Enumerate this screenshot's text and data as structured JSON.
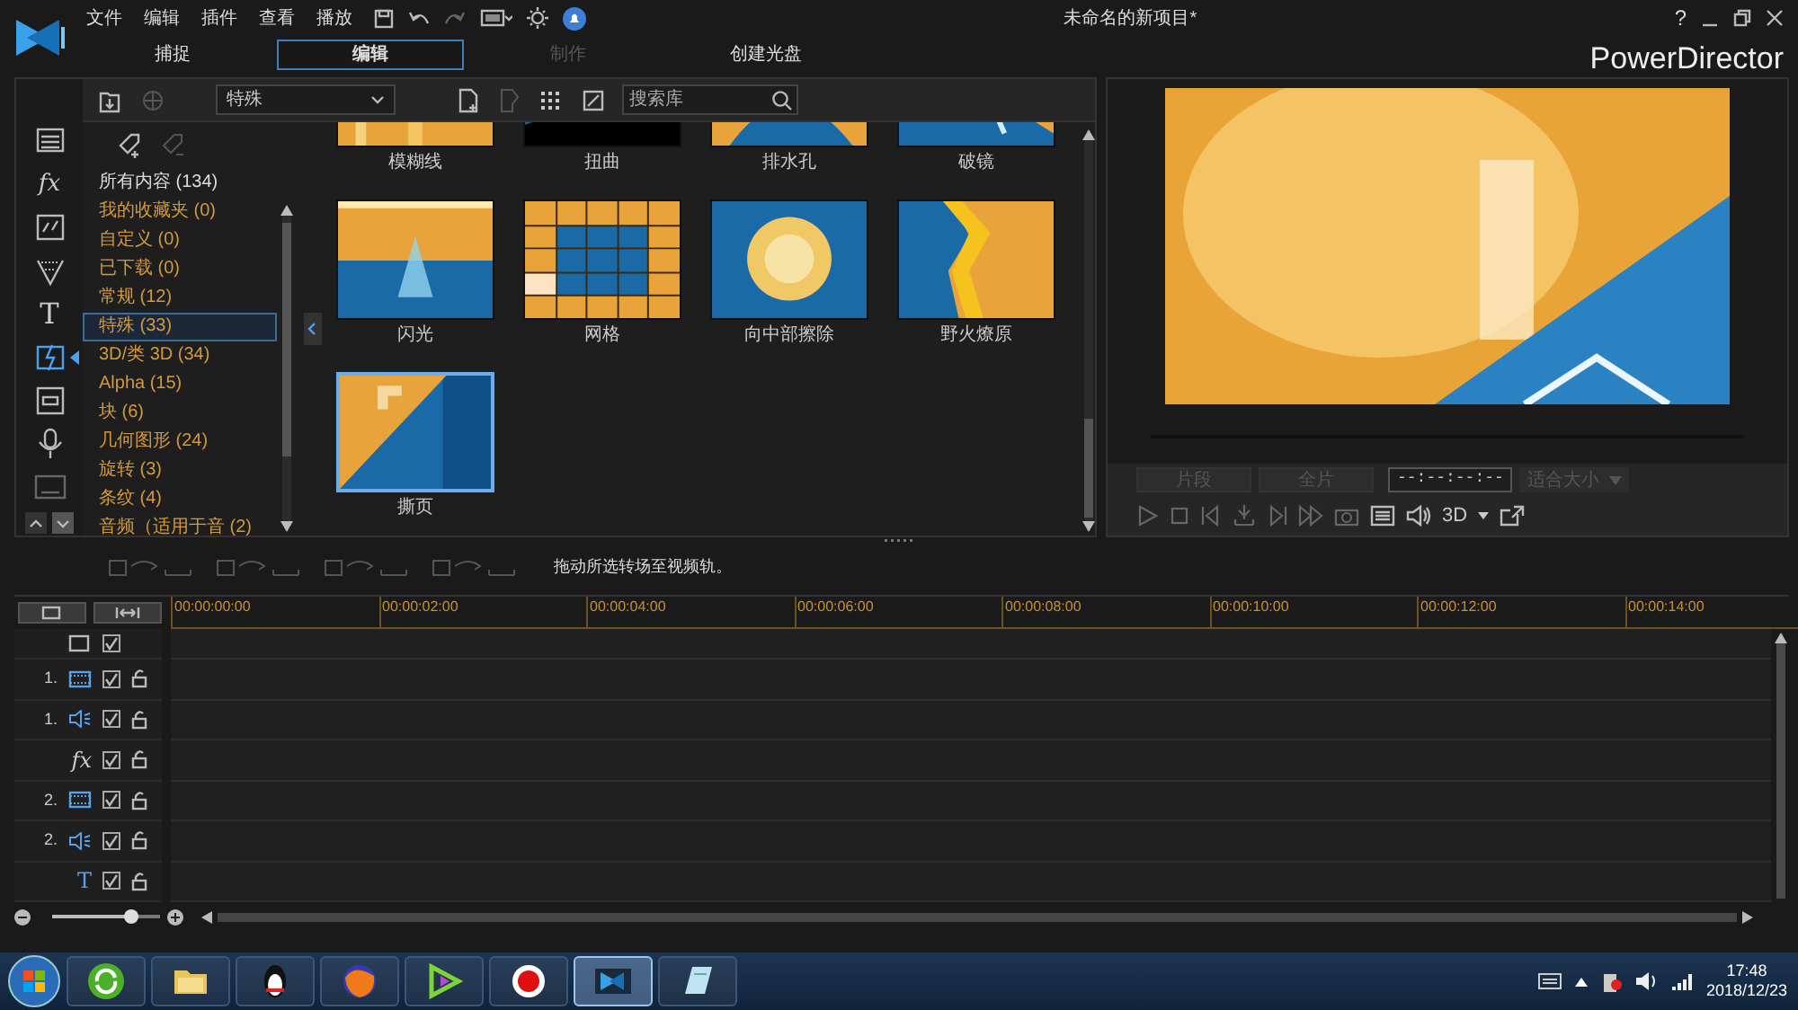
{
  "menus": [
    "文件",
    "编辑",
    "插件",
    "查看",
    "播放"
  ],
  "window": {
    "title": "未命名的新项目*",
    "help": "?"
  },
  "tabs": [
    {
      "label": "捕捉",
      "selected": false,
      "disabled": false
    },
    {
      "label": "编辑",
      "selected": true,
      "disabled": false
    },
    {
      "label": "制作",
      "selected": false,
      "disabled": true
    },
    {
      "label": "创建光盘",
      "selected": false,
      "disabled": false
    }
  ],
  "brand": "PowerDirector",
  "rail": [
    {
      "kind": "media",
      "selected": false
    },
    {
      "kind": "fx",
      "label": "fx",
      "selected": false
    },
    {
      "kind": "pip",
      "selected": false
    },
    {
      "kind": "particle",
      "selected": false
    },
    {
      "kind": "title",
      "label": "T",
      "selected": false
    },
    {
      "kind": "transition",
      "selected": true
    },
    {
      "kind": "chapter",
      "selected": false
    },
    {
      "kind": "voice",
      "selected": false
    },
    {
      "kind": "subtitle",
      "selected": false
    }
  ],
  "library": {
    "category_select": "特殊",
    "search": {
      "placeholder": "搜索库"
    },
    "categories": [
      {
        "kind": "all",
        "label": "所有内容 (134)",
        "selected": false
      },
      {
        "kind": "category",
        "label": "我的收藏夹  (0)",
        "selected": false
      },
      {
        "kind": "category",
        "label": "自定义  (0)",
        "selected": false
      },
      {
        "kind": "category",
        "label": "已下载  (0)",
        "selected": false
      },
      {
        "kind": "category",
        "label": "常规  (12)",
        "selected": false
      },
      {
        "kind": "category",
        "label": "特殊  (33)",
        "selected": true
      },
      {
        "kind": "category",
        "label": "3D/类 3D  (34)",
        "selected": false
      },
      {
        "kind": "category",
        "label": "Alpha  (15)",
        "selected": false
      },
      {
        "kind": "category",
        "label": "块  (6)",
        "selected": false
      },
      {
        "kind": "category",
        "label": "几何图形  (24)",
        "selected": false
      },
      {
        "kind": "category",
        "label": "旋转  (3)",
        "selected": false
      },
      {
        "kind": "category",
        "label": "条纹  (4)",
        "selected": false
      },
      {
        "kind": "category",
        "label": "音频（适用于音      (2)",
        "selected": false
      }
    ],
    "transitions": [
      {
        "label": "模糊线",
        "selected": false
      },
      {
        "label": "扭曲",
        "selected": false
      },
      {
        "label": "排水孔",
        "selected": false
      },
      {
        "label": "破镜",
        "selected": false
      },
      {
        "label": "闪光",
        "selected": false
      },
      {
        "label": "网格",
        "selected": false
      },
      {
        "label": "向中部擦除",
        "selected": false
      },
      {
        "label": "野火燎原",
        "selected": false
      },
      {
        "label": "撕页",
        "selected": true
      }
    ]
  },
  "preview": {
    "range_buttons": [
      "片段",
      "全片"
    ],
    "timecode": "--:--:--:--",
    "zoom": "适合大小",
    "mode": "3D"
  },
  "timeline": {
    "hint": "拖动所选转场至视频轨。",
    "ruler": [
      "00:00:00:00",
      "00:00:02:00",
      "00:00:04:00",
      "00:00:06:00",
      "00:00:08:00",
      "00:00:10:00",
      "00:00:12:00",
      "00:00:14:00"
    ],
    "tracks": [
      {
        "kind": "master",
        "checked": true
      },
      {
        "kind": "video",
        "number": "1.",
        "checked": true
      },
      {
        "kind": "audio",
        "number": "1.",
        "checked": true
      },
      {
        "kind": "fx",
        "label": "fx",
        "checked": true
      },
      {
        "kind": "video",
        "number": "2.",
        "checked": true
      },
      {
        "kind": "audio",
        "number": "2.",
        "checked": true
      },
      {
        "kind": "title",
        "label": "T",
        "checked": true
      }
    ]
  },
  "taskbar": {
    "apps": [
      {
        "active": false
      },
      {
        "active": false
      },
      {
        "active": false
      },
      {
        "active": false
      },
      {
        "active": false
      },
      {
        "active": false
      },
      {
        "active": true
      },
      {
        "active": false
      }
    ],
    "time": "17:48",
    "date": "2018/12/23"
  }
}
